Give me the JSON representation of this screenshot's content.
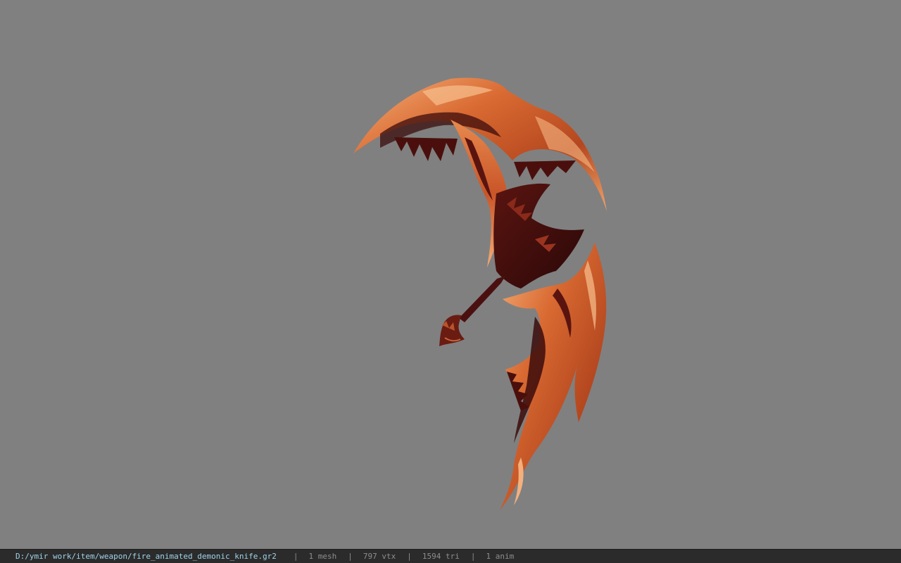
{
  "viewport": {
    "background": "#808080",
    "model_name": "fire_animated_demonic_knife"
  },
  "colors": {
    "flame_light": "#f2a06a",
    "flame_mid": "#d0652f",
    "flame_dark": "#7a2414",
    "ember": "#3b0c0c",
    "status_path": "#9fd4ea",
    "status_text": "#8e8e8e"
  },
  "status_bar": {
    "file_path": "D:/ymir work/item/weapon/fire_animated_demonic_knife.gr2",
    "separator": "|",
    "mesh_count": "1 mesh",
    "vertex_count": "797 vtx",
    "triangle_count": "1594 tri",
    "anim_count": "1 anim"
  }
}
